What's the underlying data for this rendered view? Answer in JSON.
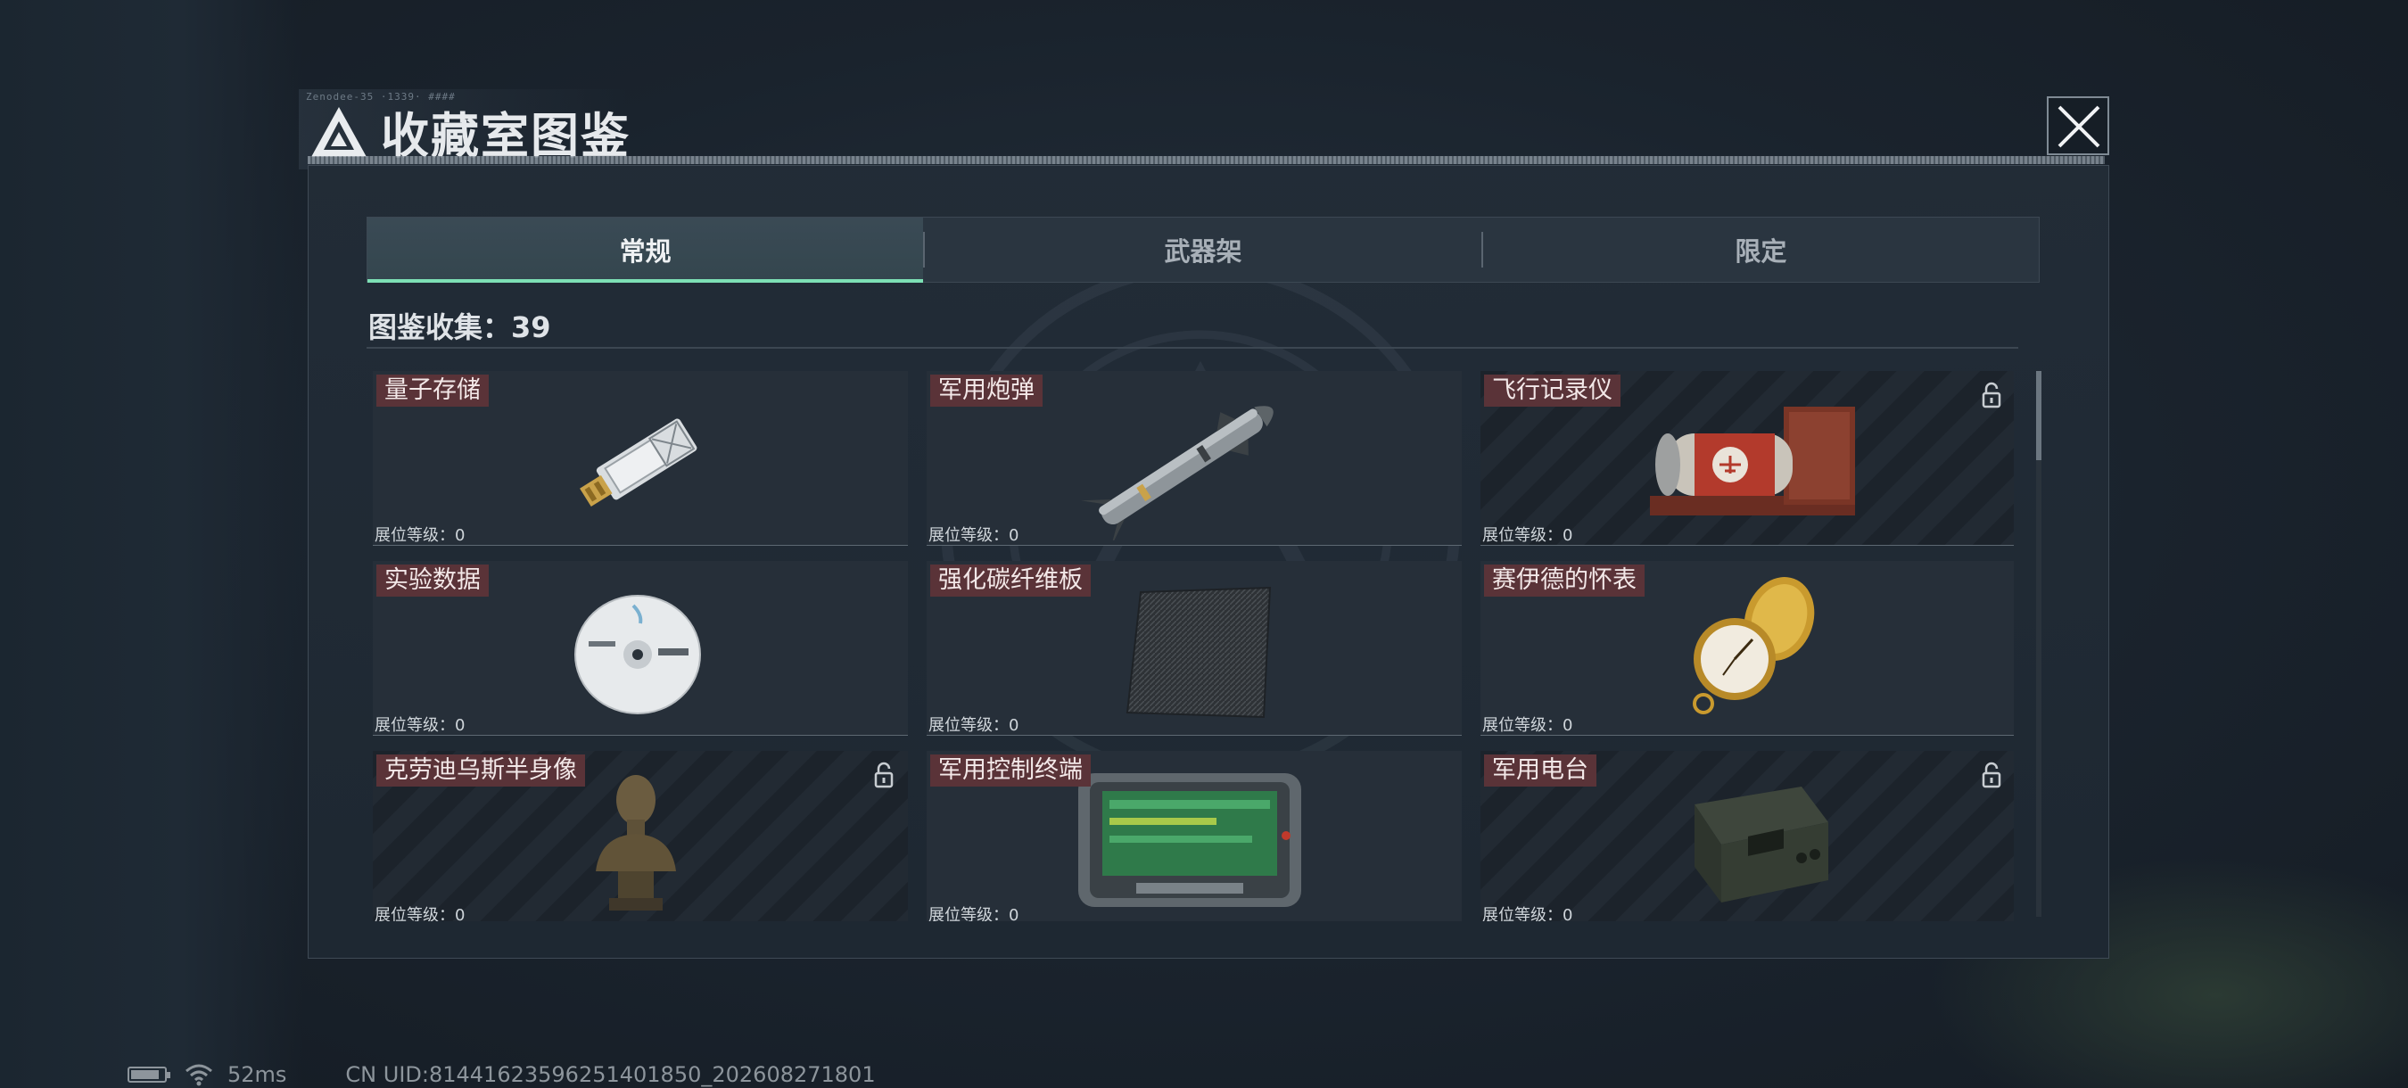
{
  "header": {
    "title": "收藏室图鉴",
    "deco_text": "Zenodee-35 ·1339· ####"
  },
  "tabs": [
    {
      "label": "常规",
      "active": true
    },
    {
      "label": "武器架",
      "active": false
    },
    {
      "label": "限定",
      "active": false
    }
  ],
  "collection": {
    "text": "图鉴收集：39"
  },
  "items": [
    {
      "name": "量子存储",
      "level_text": "展位等级：0",
      "locked": false,
      "icon": "usb-drive-icon"
    },
    {
      "name": "军用炮弹",
      "level_text": "展位等级：0",
      "locked": false,
      "icon": "missile-icon"
    },
    {
      "name": "飞行记录仪",
      "level_text": "展位等级：0",
      "locked": true,
      "icon": "flight-recorder-icon"
    },
    {
      "name": "实验数据",
      "level_text": "展位等级：0",
      "locked": false,
      "icon": "disc-icon"
    },
    {
      "name": "强化碳纤维板",
      "level_text": "展位等级：0",
      "locked": false,
      "icon": "carbon-plate-icon"
    },
    {
      "name": "赛伊德的怀表",
      "level_text": "展位等级：0",
      "locked": false,
      "icon": "pocket-watch-icon"
    },
    {
      "name": "克劳迪乌斯半身像",
      "level_text": "展位等级：0",
      "locked": true,
      "icon": "bust-statue-icon"
    },
    {
      "name": "军用控制终端",
      "level_text": "展位等级：0",
      "locked": false,
      "icon": "control-terminal-icon"
    },
    {
      "name": "军用电台",
      "level_text": "展位等级：0",
      "locked": true,
      "icon": "military-radio-icon"
    }
  ],
  "status": {
    "battery_level": 0.85,
    "ping": "52ms",
    "uid": "CN UID:81441623596251401850_202608271801"
  },
  "colors": {
    "accent": "#7de0b5",
    "badge": "#5a3338",
    "panel": "#222c37"
  }
}
